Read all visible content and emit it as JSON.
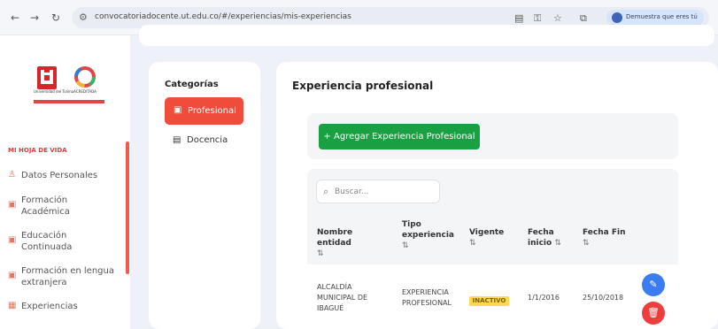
{
  "browser": {
    "url": "convocatoriadocente.ut.edu.co/#/experiencias/mis-experiencias",
    "profile_label": "Demuestra que eres tú"
  },
  "sidebar": {
    "logo_left_caption": "Universidad del Tolima",
    "logo_right_caption": "ACREDITADA",
    "section_heading": "MI HOJA DE VIDA",
    "items": [
      {
        "label": "Datos Personales",
        "icon": "user-icon"
      },
      {
        "label": "Formación Académica",
        "icon": "briefcase-icon"
      },
      {
        "label": "Educación Continuada",
        "icon": "briefcase-icon"
      },
      {
        "label": "Formación en lengua extranjera",
        "icon": "briefcase-icon"
      },
      {
        "label": "Experiencias",
        "icon": "building-icon"
      }
    ]
  },
  "categories": {
    "title": "Categorías",
    "items": [
      {
        "label": "Profesional",
        "active": true
      },
      {
        "label": "Docencia",
        "active": false
      }
    ]
  },
  "main": {
    "title": "Experiencia profesional",
    "add_button": "Agregar Experiencia Profesional",
    "search_placeholder": "Buscar...",
    "columns": [
      "Nombre entidad",
      "Tipo experiencia",
      "Vigente",
      "Fecha inicio",
      "Fecha Fin"
    ],
    "rows": [
      {
        "entidad": "ALCALDÍA MUNICIPAL DE IBAGUÉ",
        "tipo": "EXPERIENCIA PROFESIONAL",
        "vigente": "INACTIVO",
        "inicio": "1/1/2016",
        "fin": "25/10/2018"
      }
    ]
  },
  "colors": {
    "accent_red": "#ef4c3b",
    "green": "#18a043",
    "edit_blue": "#3b7cf0",
    "delete_red": "#ee3d3d",
    "badge_yellow": "#ffd84d"
  }
}
